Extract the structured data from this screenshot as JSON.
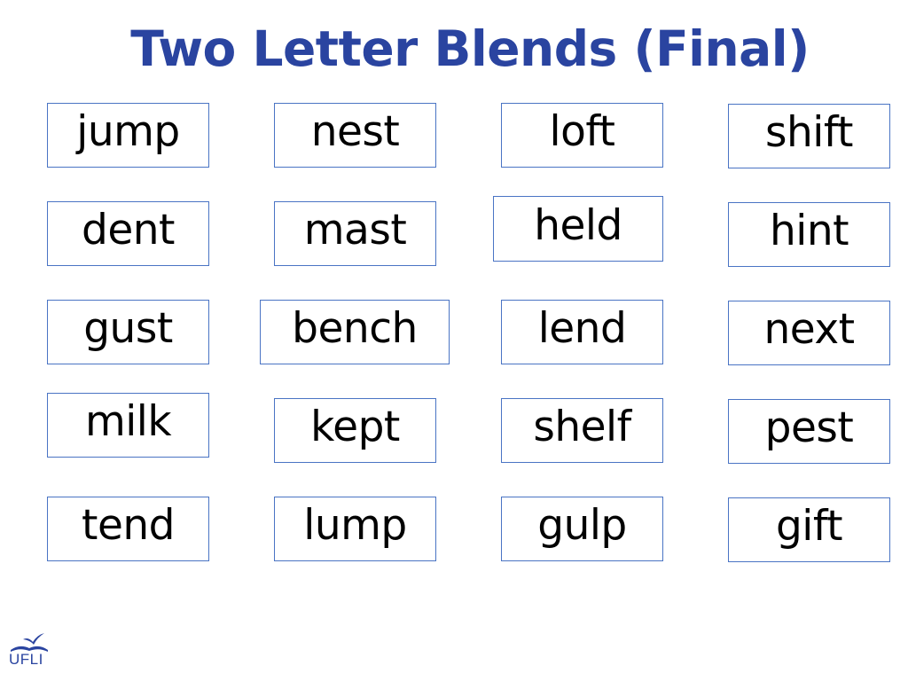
{
  "title": "Two Letter Blends (Final)",
  "colors": {
    "title": "#2a44a0",
    "card_border": "#4a74c4",
    "text": "#000000"
  },
  "words": [
    [
      "jump",
      "nest",
      "loft",
      "shift"
    ],
    [
      "dent",
      "mast",
      "held",
      "hint"
    ],
    [
      "gust",
      "bench",
      "lend",
      "next"
    ],
    [
      "milk",
      "kept",
      "shelf",
      "pest"
    ],
    [
      "tend",
      "lump",
      "gulp",
      "gift"
    ]
  ],
  "logo": {
    "icon": "open-book-bird-icon",
    "text": "UFLI"
  }
}
